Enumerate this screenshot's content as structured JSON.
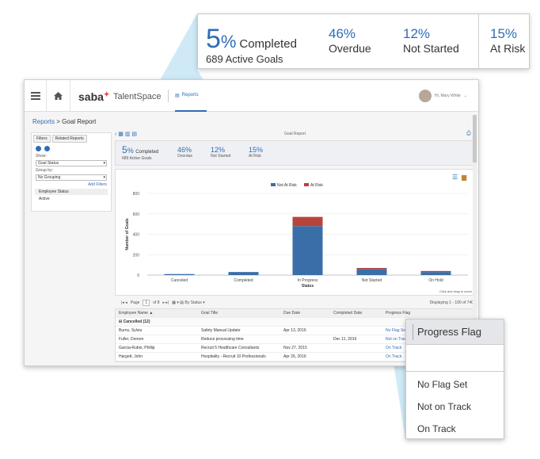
{
  "app": {
    "brand": "saba",
    "product": "TalentSpace",
    "nav_reports": "Reports",
    "user_name": "Hi, Mary White"
  },
  "breadcrumb": {
    "root": "Reports",
    "separator": ">",
    "current": "Goal Report"
  },
  "filters": {
    "tabs": [
      "Filters",
      "Related Reports"
    ],
    "show_label": "Show:",
    "show_value": "Goal Status",
    "group_label": "Group by:",
    "group_value": "No Grouping",
    "add_filters": "Add Filters",
    "section": "Employee Status",
    "section_value": "Active"
  },
  "report": {
    "title": "Goal Report"
  },
  "summary": {
    "completed_pct": "5",
    "pct_sign": "%",
    "completed_label": "Completed",
    "active_goals": "689 Active Goals",
    "overdue_pct": "46%",
    "overdue_label": "Overdue",
    "not_started_pct": "12%",
    "not_started_label": "Not Started",
    "at_risk_pct": "15%",
    "at_risk_label": "At Risk"
  },
  "chart_data": {
    "type": "bar",
    "stacked": true,
    "categories": [
      "Canceled",
      "Completed",
      "In Progress",
      "Not Started",
      "On Hold"
    ],
    "series": [
      {
        "name": "Not At Risk",
        "color": "#3a6ea8",
        "values": [
          10,
          30,
          480,
          60,
          30
        ]
      },
      {
        "name": "At Risk",
        "color": "#b8433b",
        "values": [
          0,
          0,
          90,
          10,
          10
        ]
      }
    ],
    "xlabel": "Status",
    "ylabel": "Number of Goals",
    "ylim": [
      0,
      800
    ],
    "yticks": [
      0,
      200,
      400,
      600,
      800
    ],
    "legend": "top",
    "grid": true,
    "note": "Click and drag to zoom"
  },
  "pager": {
    "page_label": "Page",
    "page_value": "1",
    "page_of": "of 8",
    "group_by": "By Status",
    "displaying": "Displaying 1 - 100 of 740"
  },
  "grid": {
    "columns": [
      "Employee Name ▲",
      "Goal Title",
      "Due Date",
      "Completed Date",
      "Progress Flag"
    ],
    "group_label": "Cancelled (12)",
    "rows": [
      [
        "Burns, Sylvia",
        "Safety Manual Update",
        "Apr 13, 2016",
        "",
        "No Flag Set"
      ],
      [
        "Fuller, Doreen",
        "Reduce processing time",
        "",
        "Dec 11, 2016",
        "Not on Track"
      ],
      [
        "Garcia-Rubio, Phillip",
        "Recruit 5 Healthcare Consultants",
        "Nov 27, 2015",
        "",
        "On Track"
      ],
      [
        "Hargett, John",
        "Hospitality - Recruit 10 Professionals",
        "Apr 26, 2016",
        "",
        "On Track"
      ]
    ]
  },
  "flag_menu": {
    "header": "Progress Flag",
    "items": [
      "No Flag Set",
      "Not on Track",
      "On Track"
    ]
  },
  "colors": {
    "accent": "#2f6db5",
    "not_at_risk": "#3a6ea8",
    "at_risk": "#b8433b",
    "beam": "#bfe3f3"
  }
}
